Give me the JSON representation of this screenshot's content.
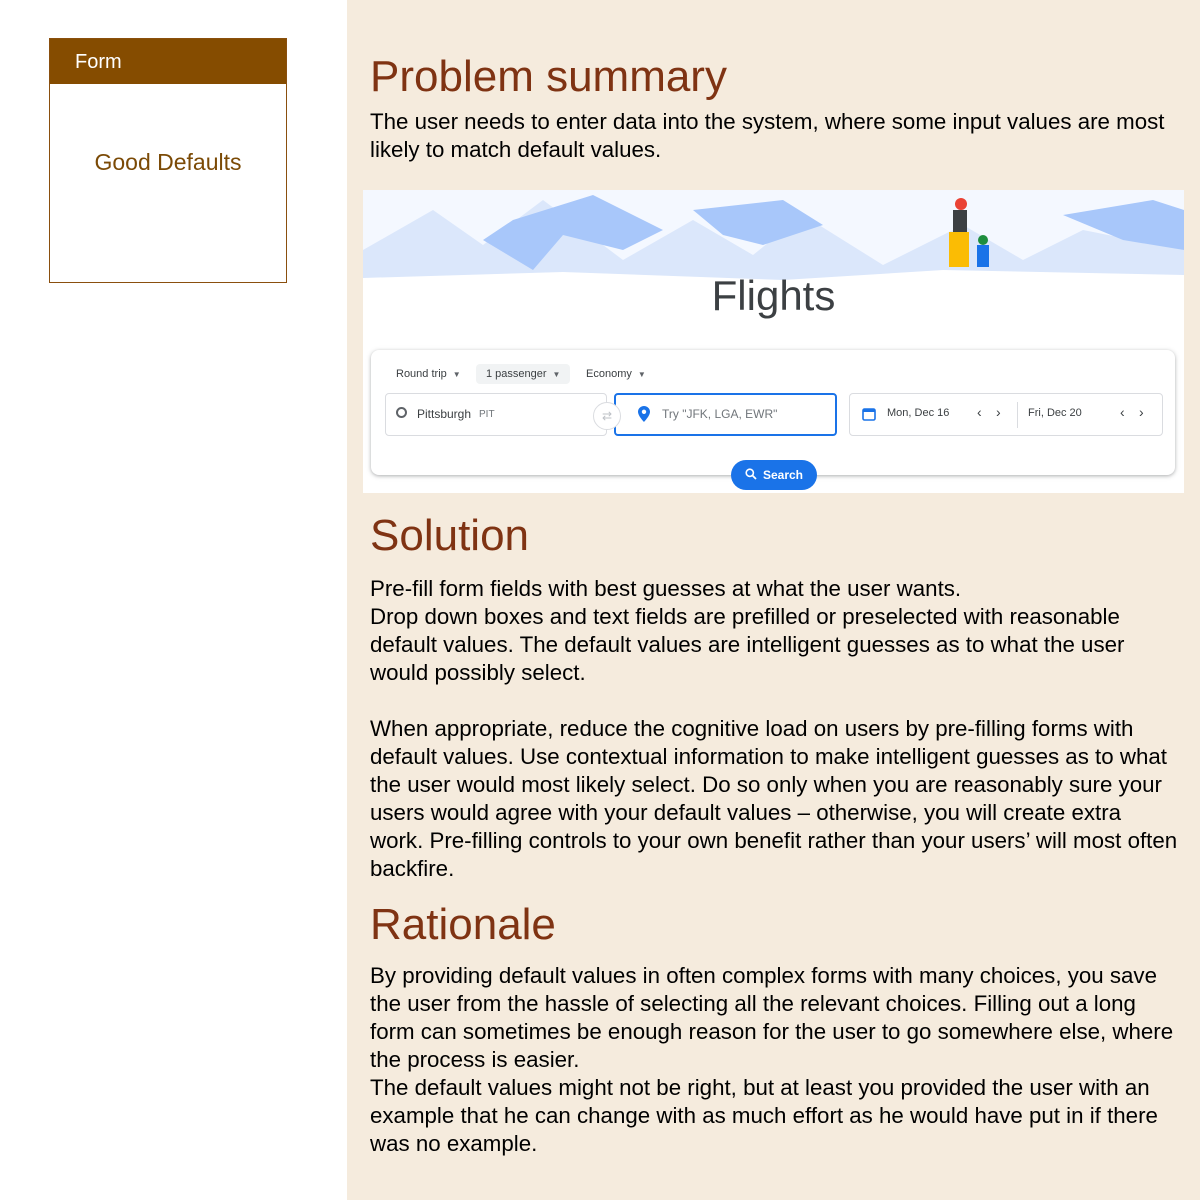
{
  "card": {
    "header": "Form",
    "title": "Good Defaults"
  },
  "sections": {
    "problem": {
      "heading": "Problem summary",
      "text": "The user needs to enter data into the system, where some input values are most likely to match default values."
    },
    "solution": {
      "heading": "Solution",
      "line1": "Pre-fill form fields with best guesses at what the user wants.",
      "line2": "Drop down boxes and text fields are prefilled or preselected with reasonable default values. The default values are intelligent guesses as to what the user would possibly select.",
      "line3": "When appropriate, reduce the cognitive load on users by pre-filling forms with default values. Use contextual information to make intelligent guesses as to what the user would most likely select. Do so only when you are reasonably sure your users would agree with your default values – otherwise, you will create extra work. Pre-filling controls to your own benefit rather than your users’ will most often backfire."
    },
    "rationale": {
      "heading": "Rationale",
      "line1": "By providing default values in often complex forms with many choices, you save the user from the hassle of selecting all the relevant choices. Filling out a long form can sometimes be enough reason for the user to go somewhere else, where the process is easier.",
      "line2": "The default values might not be right, but at least you provided the user with an example that he can change with as much effort as he would have put in if there was no example."
    }
  },
  "screenshot": {
    "title": "Flights",
    "trip_type": "Round trip",
    "passengers": "1 passenger",
    "cabin": "Economy",
    "origin_city": "Pittsburgh",
    "origin_code": "PIT",
    "destination_placeholder": "Try \"JFK, LGA, EWR\"",
    "depart_date": "Mon, Dec 16",
    "return_date": "Fri, Dec 20",
    "search_label": "Search",
    "colors": {
      "accent": "#1a73e8",
      "mountains": "#a8c7fa",
      "figure_red": "#ea4335",
      "figure_yellow": "#fbbc04"
    }
  }
}
